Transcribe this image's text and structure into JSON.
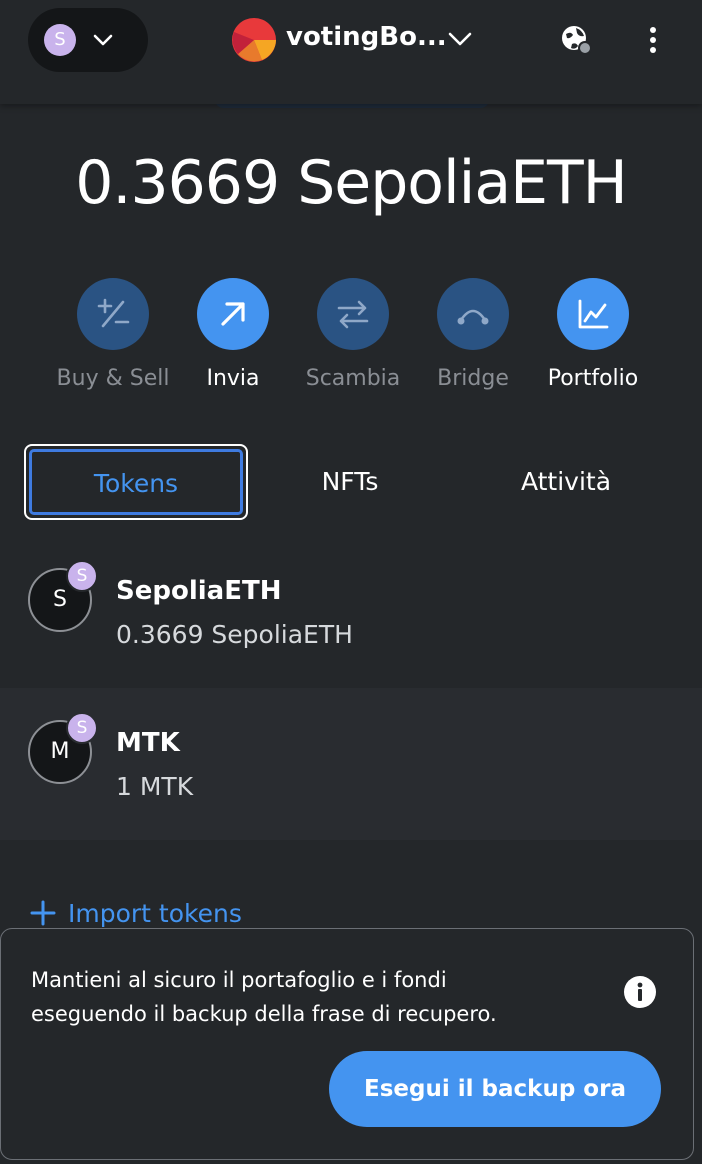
{
  "header": {
    "network_avatar_letter": "S",
    "account_name": "votingBo...",
    "icons": [
      "chevron-down-icon",
      "account-logo-icon",
      "globe-connection-icon",
      "kebab-menu-icon"
    ]
  },
  "balance": {
    "display": "0.3669 SepoliaETH"
  },
  "actions": [
    {
      "label": "Buy & Sell",
      "icon": "buy-sell-icon",
      "enabled": false
    },
    {
      "label": "Invia",
      "icon": "send-arrow-icon",
      "enabled": true
    },
    {
      "label": "Scambia",
      "icon": "swap-icon",
      "enabled": false
    },
    {
      "label": "Bridge",
      "icon": "bridge-icon",
      "enabled": false
    },
    {
      "label": "Portfolio",
      "icon": "portfolio-chart-icon",
      "enabled": true
    }
  ],
  "tabs": [
    {
      "label": "Tokens",
      "active": true
    },
    {
      "label": "NFTs",
      "active": false
    },
    {
      "label": "Attività",
      "active": false
    }
  ],
  "tokens": [
    {
      "icon_letter": "S",
      "badge_letter": "S",
      "name": "SepoliaETH",
      "balance": "0.3669 SepoliaETH"
    },
    {
      "icon_letter": "M",
      "badge_letter": "S",
      "name": "MTK",
      "balance": "1 MTK"
    }
  ],
  "import_tokens": {
    "label": "Import tokens"
  },
  "backup_banner": {
    "line1": "Mantieni al sicuro il portafoglio e i fondi",
    "line2": "eseguendo il backup della frase di recupero.",
    "button_label": "Esegui il backup ora"
  },
  "colors": {
    "background": "#24272a",
    "accent": "#4494f0",
    "accent_dim": "#2a5383",
    "network_avatar": "#c9b3ec"
  }
}
